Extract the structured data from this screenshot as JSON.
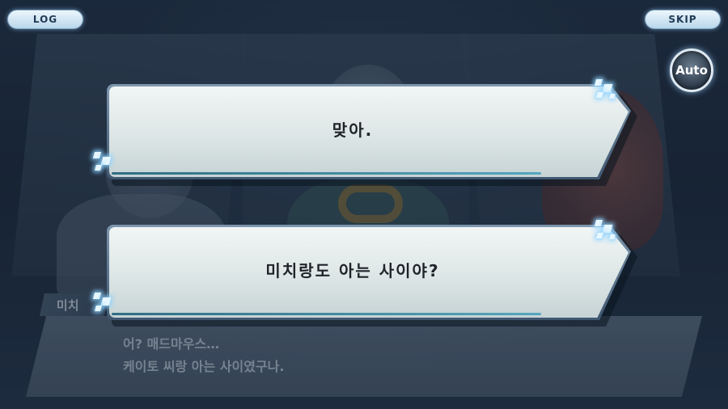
{
  "top_bar": {
    "log_label": "LOG",
    "skip_label": "SKIP",
    "auto_label": "Auto"
  },
  "dialogue": {
    "speaker": "미치",
    "lines": [
      "어? 매드마우스…",
      "케이토 씨랑 아는 사이였구나."
    ]
  },
  "choices": [
    {
      "label": "맞아."
    },
    {
      "label": "미치랑도 아는 사이야?"
    }
  ]
}
